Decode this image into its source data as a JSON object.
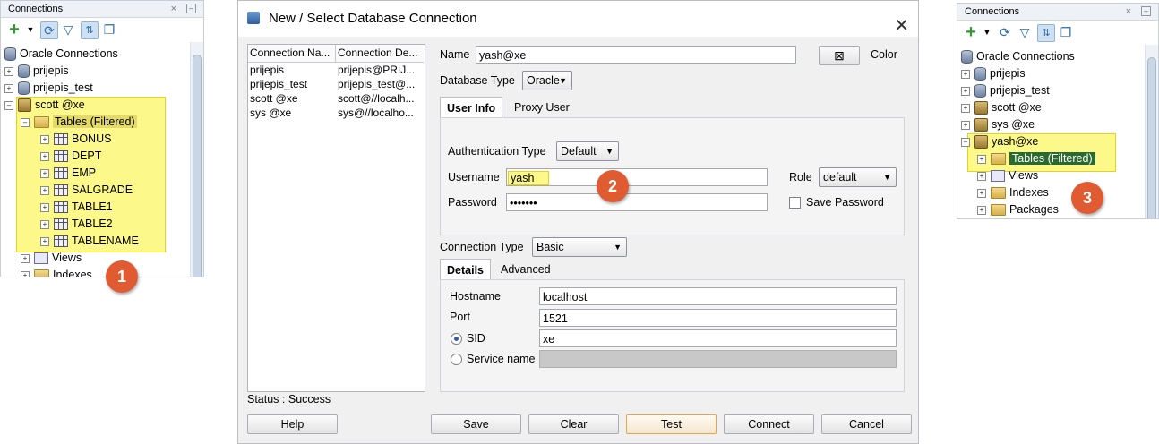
{
  "panel1": {
    "title": "Connections",
    "root": "Oracle Connections",
    "connections": [
      "prijepis",
      "prijepis_test"
    ],
    "active_connection": "scott @xe",
    "tables_node": "Tables (Filtered)",
    "tables": [
      "BONUS",
      "DEPT",
      "EMP",
      "SALGRADE",
      "TABLE1",
      "TABLE2",
      "TABLENAME"
    ],
    "after": [
      "Views",
      "Indexes"
    ],
    "badge": "1"
  },
  "dialog": {
    "title": "New / Select Database Connection",
    "grid": {
      "headers": [
        "Connection Na...",
        "Connection De..."
      ],
      "rows": [
        [
          "prijepis",
          "prijepis@PRIJ..."
        ],
        [
          "prijepis_test",
          "prijepis_test@..."
        ],
        [
          "scott @xe",
          "scott@//localh..."
        ],
        [
          "sys @xe",
          "sys@//localho..."
        ]
      ]
    },
    "name_label": "Name",
    "name_value": "yash@xe",
    "color_label": "Color",
    "db_type_label": "Database Type",
    "db_type_value": "Oracle",
    "tabs": [
      "User Info",
      "Proxy User"
    ],
    "auth_label": "Authentication Type",
    "auth_value": "Default",
    "username_label": "Username",
    "username_value": "yash",
    "password_label": "Password",
    "password_value": "•••••••",
    "role_label": "Role",
    "role_value": "default",
    "save_password_label": "Save Password",
    "conn_type_label": "Connection Type",
    "conn_type_value": "Basic",
    "detail_tabs": [
      "Details",
      "Advanced"
    ],
    "hostname_label": "Hostname",
    "hostname_value": "localhost",
    "port_label": "Port",
    "port_value": "1521",
    "sid_label": "SID",
    "sid_value": "xe",
    "service_label": "Service name",
    "status": "Status : Success",
    "buttons": {
      "help": "Help",
      "save": "Save",
      "clear": "Clear",
      "test": "Test",
      "connect": "Connect",
      "cancel": "Cancel"
    },
    "badge": "2"
  },
  "panel3": {
    "title": "Connections",
    "root": "Oracle Connections",
    "connections": [
      "prijepis",
      "prijepis_test",
      "scott @xe",
      "sys @xe"
    ],
    "active_connection": "yash@xe",
    "tables_node": "Tables (Filtered)",
    "after": [
      "Views",
      "Indexes",
      "Packages"
    ],
    "badge": "3"
  },
  "colors": {
    "highlight": "#fcf98a",
    "badge": "#e05a32",
    "selected_row": "#2b6a2e"
  }
}
